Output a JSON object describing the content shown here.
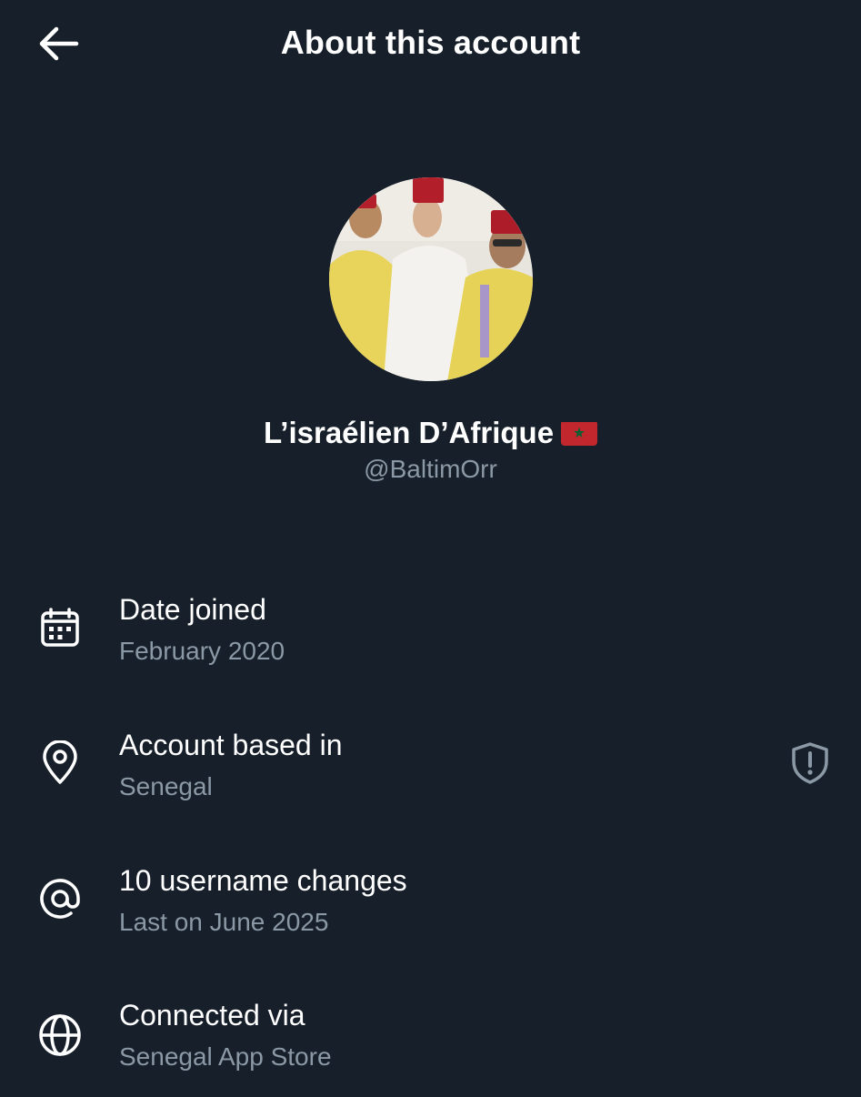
{
  "header": {
    "title": "About this account",
    "back_icon": "arrow-left-icon"
  },
  "profile": {
    "display_name": "L’israélien D’Afrique",
    "flag_emoji": "morocco-flag",
    "handle": "@BaltimOrr"
  },
  "rows": [
    {
      "icon": "calendar-icon",
      "label": "Date joined",
      "value": "February 2020"
    },
    {
      "icon": "location-pin-icon",
      "label": "Account based in",
      "value": "Senegal",
      "trailing_icon": "shield-alert-icon"
    },
    {
      "icon": "at-sign-icon",
      "label": "10 username changes",
      "value": "Last on June 2025"
    },
    {
      "icon": "globe-icon",
      "label": "Connected via",
      "value": "Senegal App Store"
    }
  ],
  "colors": {
    "background": "#17202a",
    "text_primary": "#ffffff",
    "text_secondary": "#8b98a5",
    "icon_muted": "#8b98a5"
  }
}
